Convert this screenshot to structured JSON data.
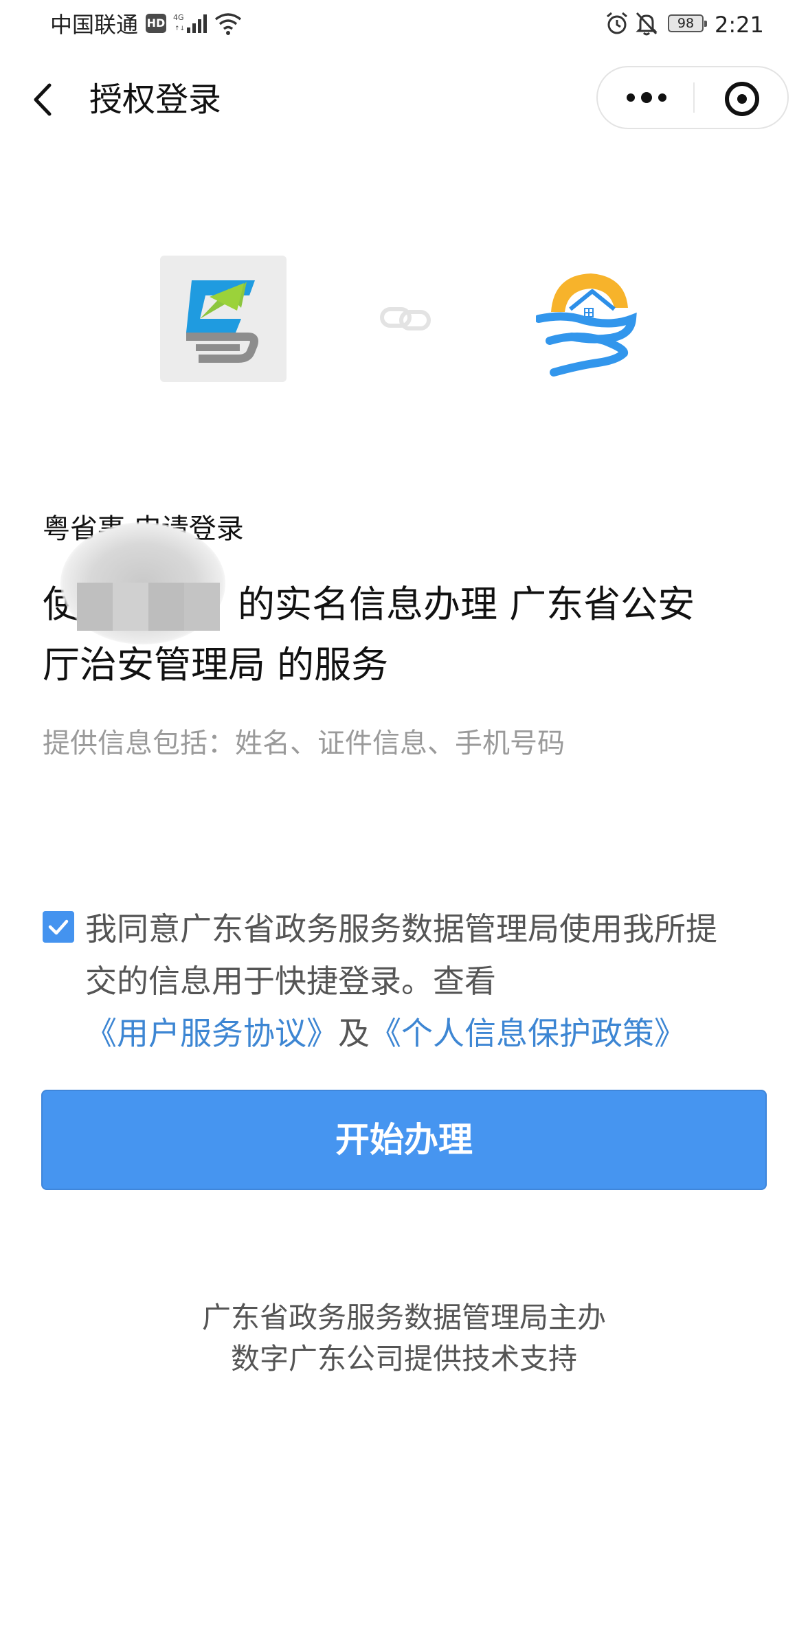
{
  "status_bar": {
    "carrier": "中国联通",
    "hd": "HD",
    "network": "4G",
    "battery": "98",
    "time": "2:21"
  },
  "nav": {
    "title": "授权登录"
  },
  "auth": {
    "app_request": "粤省事 申请登录",
    "main_text": "使用 的实名信息办理 广东省公安厅治安管理局 的服务",
    "main_prefix": "使",
    "main_line1_rest": "的实名信息办理 广东省公安",
    "main_line2": "厅治安管理局 的服务",
    "info_list": "提供信息包括：姓名、证件信息、手机号码"
  },
  "agreement": {
    "checked": true,
    "text_before": "我同意广东省政务服务数据管理局使用我所提交的信息用于快捷登录。查看",
    "user_agreement_link": "《用户服务协议》",
    "conjunction": "及",
    "privacy_policy_link": "《个人信息保护政策》"
  },
  "actions": {
    "start_label": "开始办理"
  },
  "footer": {
    "line1": "广东省政务服务数据管理局主办",
    "line2": "数字广东公司提供技术支持"
  },
  "colors": {
    "primary": "#4695f0",
    "link": "#3d86d3",
    "muted_text": "#9a9a9a"
  },
  "icons": [
    "back-arrow-icon",
    "more-dots-icon",
    "close-target-icon",
    "link-chain-icon",
    "checkbox-checked-icon",
    "alarm-icon",
    "bell-muted-icon",
    "wifi-icon",
    "signal-icon"
  ]
}
